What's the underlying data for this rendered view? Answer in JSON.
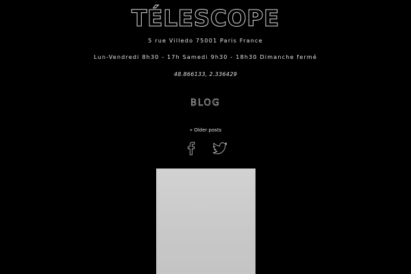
{
  "site": {
    "title": "TÉLESCOPE"
  },
  "info": {
    "address": "5 rue Villedo 75001 Paris France",
    "hours": "Lun-Vendredi 8h30 - 17h  Samedi 9h30 - 18h30  Dimanche fermé",
    "coordinates": "48.866133, 2.336429"
  },
  "nav": {
    "blog_label": "BLOG",
    "older_posts_label": "« Older posts"
  },
  "social": {
    "facebook_icon": "facebook-icon",
    "twitter_icon": "twitter-icon"
  },
  "colors": {
    "background": "#000000",
    "text": "#e6e6e6",
    "photo_placeholder": "#c8c8c8"
  }
}
